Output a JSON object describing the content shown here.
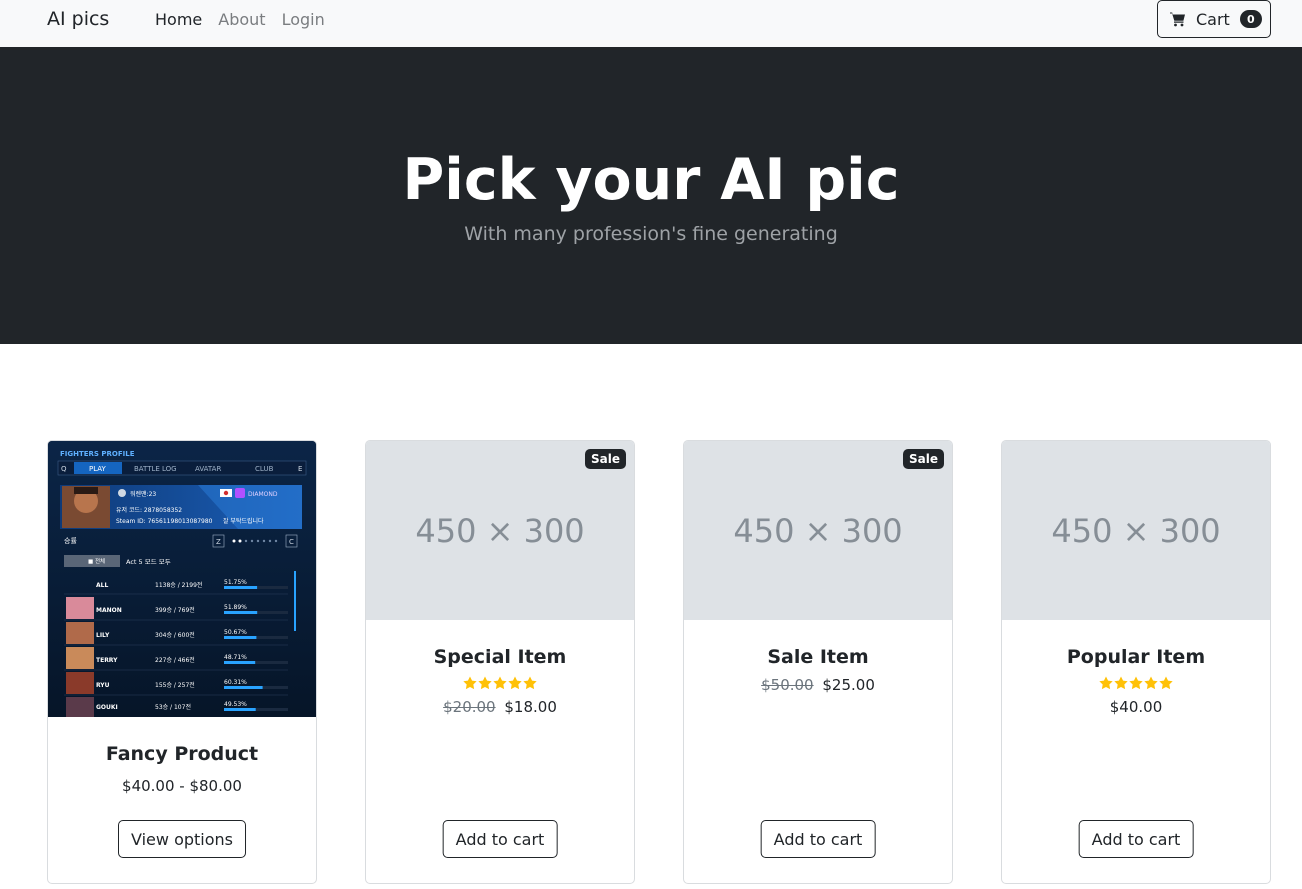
{
  "nav": {
    "brand": "AI pics",
    "links": [
      {
        "label": "Home",
        "active": true
      },
      {
        "label": "About",
        "active": false
      },
      {
        "label": "Login",
        "active": false
      }
    ],
    "cart_label": "Cart",
    "cart_count": "0"
  },
  "hero": {
    "title": "Pick your AI pic",
    "subtitle": "With many profession's fine generating"
  },
  "products": [
    {
      "name": "Fancy Product",
      "price": "$40.00 - $80.00",
      "old_price": "",
      "badge": "",
      "rating": 0,
      "image": "photo",
      "button": "View options"
    },
    {
      "name": "Special Item",
      "price": "$18.00",
      "old_price": "$20.00",
      "badge": "Sale",
      "rating": 5,
      "image": "450 × 300",
      "button": "Add to cart"
    },
    {
      "name": "Sale Item",
      "price": "$25.00",
      "old_price": "$50.00",
      "badge": "Sale",
      "rating": 0,
      "image": "450 × 300",
      "button": "Add to cart"
    },
    {
      "name": "Popular Item",
      "price": "$40.00",
      "old_price": "",
      "badge": "",
      "rating": 5,
      "image": "450 × 300",
      "button": "Add to cart"
    }
  ],
  "photo_text": {
    "header": "FIGHTERS PROFILE",
    "tabs": [
      "Q",
      "PLAY",
      "BATTLE LOG",
      "AVATAR",
      "CLUB",
      "E"
    ],
    "user": "워렌맨:23",
    "rank": "DIAMOND",
    "code_line": "유저 코드: 2878058352",
    "steam_line": "Steam ID: 76561198013087980",
    "status": "잘 부탁드립니다",
    "section": "승률",
    "keys": [
      "Z",
      "C"
    ],
    "filter": "Act 5 모드 모두",
    "filter_box": "■ 전체",
    "rows": [
      {
        "name": "ALL",
        "record": "1138승 / 2199전",
        "pct": "51.75%",
        "rate": 51.75
      },
      {
        "name": "MANON",
        "record": "399승 / 769전",
        "pct": "51.89%",
        "rate": 51.89
      },
      {
        "name": "LILY",
        "record": "304승 / 600전",
        "pct": "50.67%",
        "rate": 50.67
      },
      {
        "name": "TERRY",
        "record": "227승 / 466전",
        "pct": "48.71%",
        "rate": 48.71
      },
      {
        "name": "RYU",
        "record": "155승 / 257전",
        "pct": "60.31%",
        "rate": 60.31
      },
      {
        "name": "GOUKI",
        "record": "53승 / 107전",
        "pct": "49.53%",
        "rate": 49.53
      }
    ]
  },
  "colors": {
    "dark": "#212529",
    "star": "#ffc107",
    "placeholder_bg": "#dee2e6",
    "accent_blue": "#29a3ff"
  }
}
